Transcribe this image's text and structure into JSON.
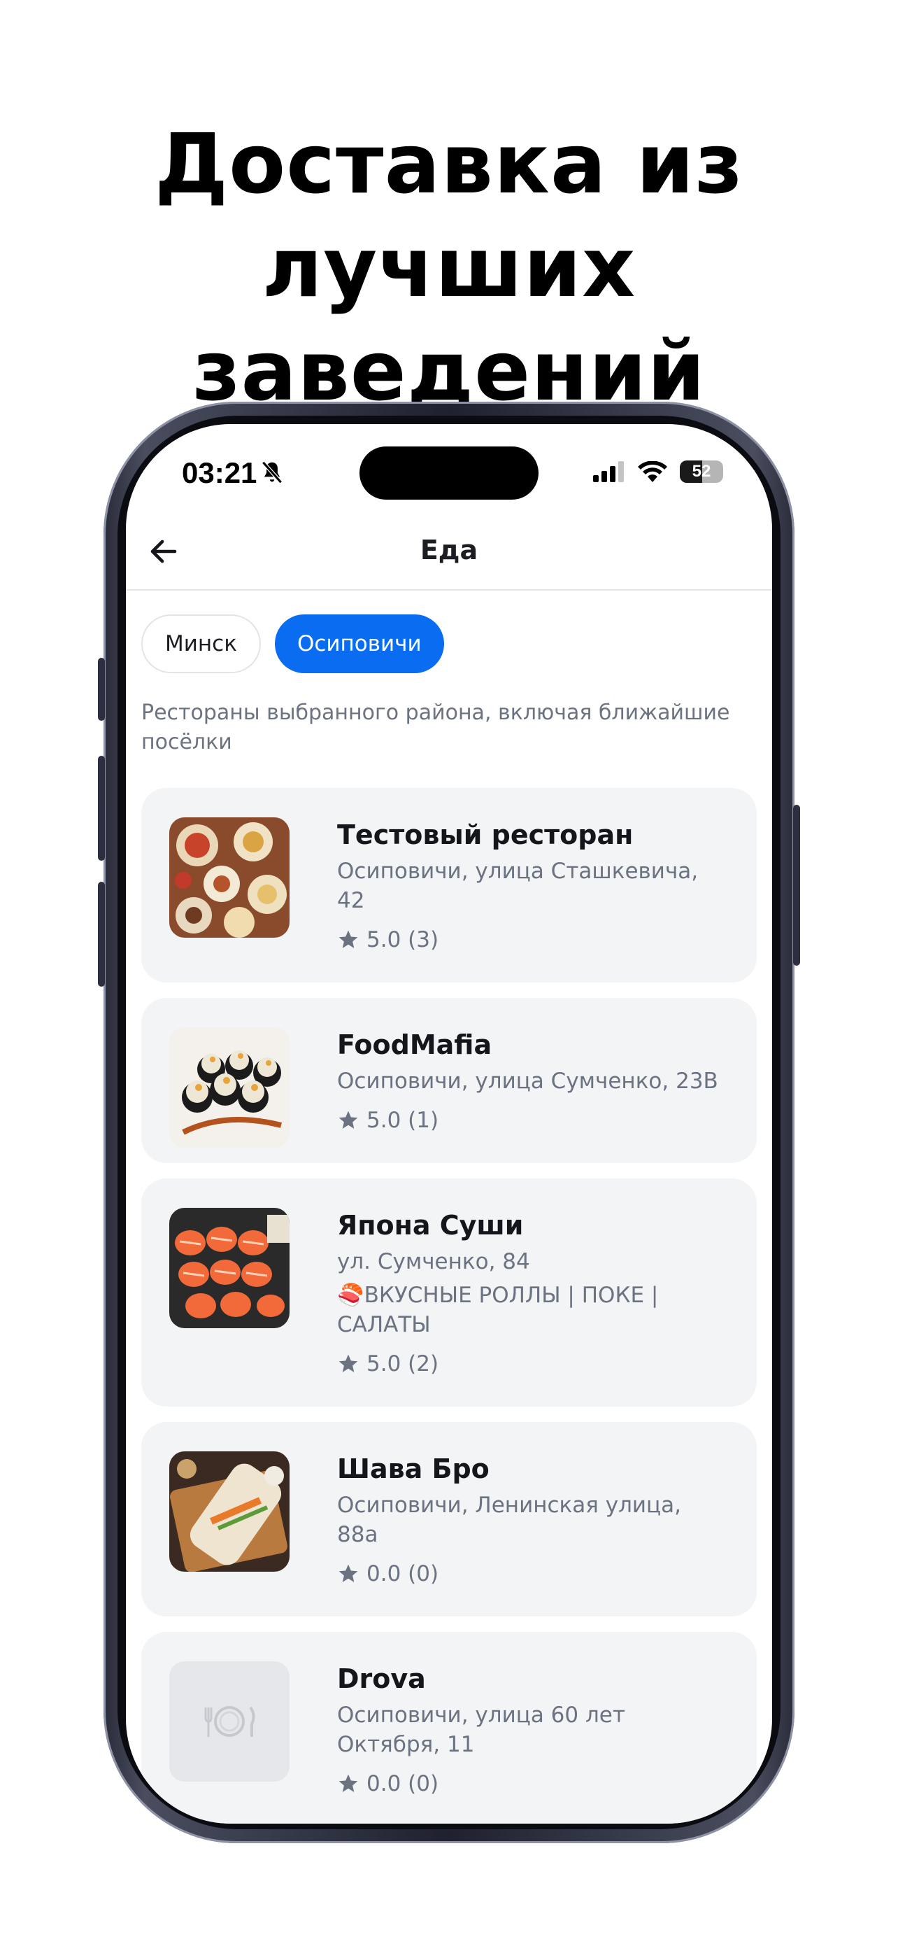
{
  "headline": {
    "line1": "Доставка из",
    "line2": "лучших заведений"
  },
  "status_bar": {
    "time": "03:21",
    "battery": "52"
  },
  "navbar": {
    "title": "Еда"
  },
  "city_chips": [
    {
      "label": "Минск",
      "selected": false
    },
    {
      "label": "Осиповичи",
      "selected": true
    }
  ],
  "hint": "Рестораны выбранного района, включая ближайшие посёлки",
  "restaurants": [
    {
      "name": "Тестовый ресторан",
      "address": "Осиповичи, улица Сташкевича, 42",
      "description": "",
      "rating": "5.0 (3)",
      "image": "food-platter"
    },
    {
      "name": "FoodMafia",
      "address": "Осиповичи, улица Сумченко, 23В",
      "description": "",
      "rating": "5.0 (1)",
      "image": "sushi-rolls"
    },
    {
      "name": "Япона Суши",
      "address": "ул. Сумченко, 84",
      "description": "🍣ВКУСНЫЕ РОЛЛЫ | ПОКЕ | САЛАТЫ",
      "rating": "5.0 (2)",
      "image": "salmon-rolls"
    },
    {
      "name": "Шава Бро",
      "address": "Осиповичи, Ленинская улица, 88а",
      "description": "",
      "rating": "0.0 (0)",
      "image": "shawarma"
    },
    {
      "name": "Drova",
      "address": "Осиповичи, улица 60 лет Октября, 11",
      "description": "",
      "rating": "0.0 (0)",
      "image": "plate-placeholder"
    }
  ],
  "colors": {
    "accent": "#0a6cf0",
    "card_bg": "#f3f4f6",
    "muted_text": "#6b7280"
  }
}
